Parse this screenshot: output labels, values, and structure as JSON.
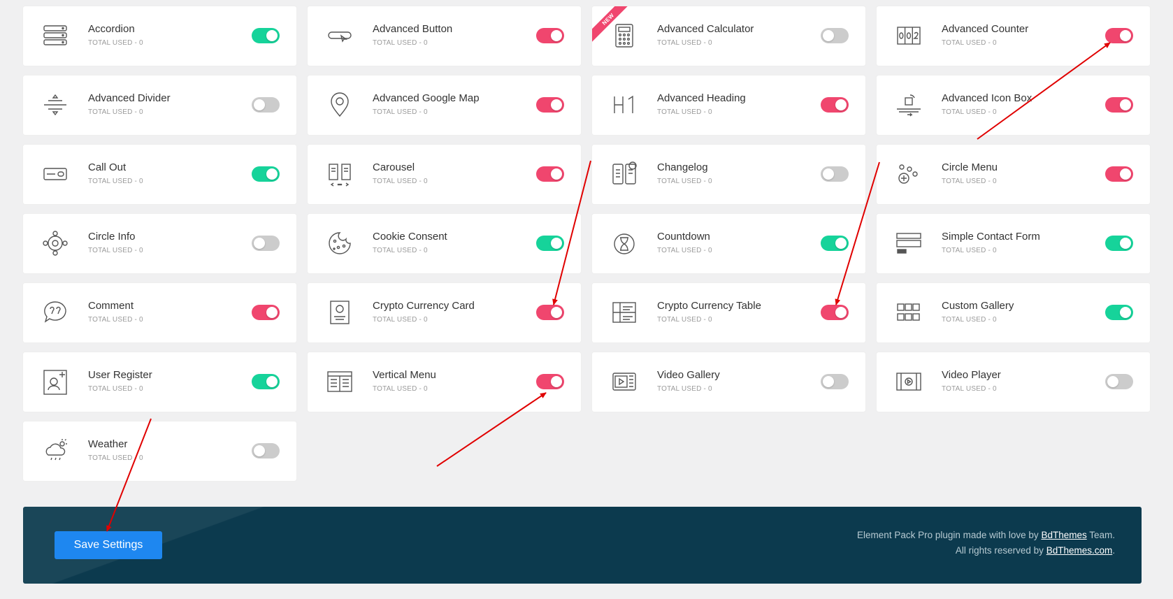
{
  "colors": {
    "toggle_on_green": "#16d39a",
    "toggle_on_pink": "#f0466e",
    "toggle_off": "#cccccc",
    "footer_bg": "#0c3a4e",
    "save_button": "#1e87f0",
    "badge_bg": "#f0466e",
    "annotation_arrow": "#e00000"
  },
  "used_label": "TOTAL USED - 0",
  "widgets": [
    {
      "name": "Accordion",
      "used": "TOTAL USED - 0",
      "enabled": true,
      "color": "green",
      "icon": "accordion-icon"
    },
    {
      "name": "Advanced Button",
      "used": "TOTAL USED - 0",
      "enabled": true,
      "color": "pink",
      "icon": "button-icon"
    },
    {
      "name": "Advanced Calculator",
      "used": "TOTAL USED - 0",
      "enabled": false,
      "color": "off",
      "icon": "calculator-icon",
      "badge": "NEW"
    },
    {
      "name": "Advanced Counter",
      "used": "TOTAL USED - 0",
      "enabled": true,
      "color": "pink",
      "icon": "counter-icon"
    },
    {
      "name": "Advanced Divider",
      "used": "TOTAL USED - 0",
      "enabled": false,
      "color": "off",
      "icon": "divider-icon"
    },
    {
      "name": "Advanced Google Map",
      "used": "TOTAL USED - 0",
      "enabled": true,
      "color": "pink",
      "icon": "map-pin-icon"
    },
    {
      "name": "Advanced Heading",
      "used": "TOTAL USED - 0",
      "enabled": true,
      "color": "pink",
      "icon": "heading-icon"
    },
    {
      "name": "Advanced Icon Box",
      "used": "TOTAL USED - 0",
      "enabled": true,
      "color": "pink",
      "icon": "icon-box-icon"
    },
    {
      "name": "Call Out",
      "used": "TOTAL USED - 0",
      "enabled": true,
      "color": "green",
      "icon": "call-out-icon"
    },
    {
      "name": "Carousel",
      "used": "TOTAL USED - 0",
      "enabled": true,
      "color": "pink",
      "icon": "carousel-icon"
    },
    {
      "name": "Changelog",
      "used": "TOTAL USED - 0",
      "enabled": false,
      "color": "off",
      "icon": "changelog-icon"
    },
    {
      "name": "Circle Menu",
      "used": "TOTAL USED - 0",
      "enabled": true,
      "color": "pink",
      "icon": "circle-menu-icon"
    },
    {
      "name": "Circle Info",
      "used": "TOTAL USED - 0",
      "enabled": false,
      "color": "off",
      "icon": "circle-info-icon"
    },
    {
      "name": "Cookie Consent",
      "used": "TOTAL USED - 0",
      "enabled": true,
      "color": "green",
      "icon": "cookie-icon"
    },
    {
      "name": "Countdown",
      "used": "TOTAL USED - 0",
      "enabled": true,
      "color": "green",
      "icon": "hourglass-icon"
    },
    {
      "name": "Simple Contact Form",
      "used": "TOTAL USED - 0",
      "enabled": true,
      "color": "green",
      "icon": "contact-form-icon"
    },
    {
      "name": "Comment",
      "used": "TOTAL USED - 0",
      "enabled": true,
      "color": "pink",
      "icon": "comment-icon"
    },
    {
      "name": "Crypto Currency Card",
      "used": "TOTAL USED - 0",
      "enabled": true,
      "color": "pink",
      "icon": "crypto-card-icon"
    },
    {
      "name": "Crypto Currency Table",
      "used": "TOTAL USED - 0",
      "enabled": true,
      "color": "pink",
      "icon": "crypto-table-icon"
    },
    {
      "name": "Custom Gallery",
      "used": "TOTAL USED - 0",
      "enabled": true,
      "color": "green",
      "icon": "gallery-icon"
    },
    {
      "name": "User Register",
      "used": "TOTAL USED - 0",
      "enabled": true,
      "color": "green",
      "icon": "user-register-icon"
    },
    {
      "name": "Vertical Menu",
      "used": "TOTAL USED - 0",
      "enabled": true,
      "color": "pink",
      "icon": "vertical-menu-icon"
    },
    {
      "name": "Video Gallery",
      "used": "TOTAL USED - 0",
      "enabled": false,
      "color": "off",
      "icon": "video-gallery-icon"
    },
    {
      "name": "Video Player",
      "used": "TOTAL USED - 0",
      "enabled": false,
      "color": "off",
      "icon": "video-player-icon"
    },
    {
      "name": "Weather",
      "used": "TOTAL USED - 0",
      "enabled": false,
      "color": "off",
      "icon": "weather-icon"
    }
  ],
  "footer": {
    "save_label": "Save Settings",
    "line1_prefix": "Element Pack Pro plugin made with love by ",
    "line1_link": "BdThemes",
    "line1_suffix": " Team.",
    "line2_prefix": "All rights reserved by ",
    "line2_link": "BdThemes.com",
    "line2_suffix": "."
  }
}
